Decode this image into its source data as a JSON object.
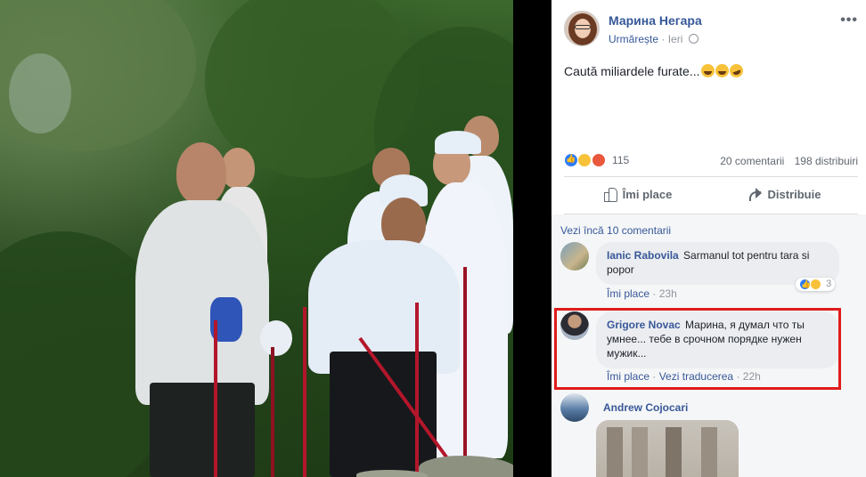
{
  "post": {
    "author": "Марина Негара",
    "follow_label": "Urmărește",
    "separator": "·",
    "time": "Ieri",
    "text": "Caută miliardele furate...",
    "reaction_count": "115",
    "comments_count": "20 comentarii",
    "shares_count": "198 distribuiri",
    "more_icon": "more-horizontal-icon"
  },
  "actions": {
    "like_label": "Îmi place",
    "share_label": "Distribuie"
  },
  "comments_section": {
    "view_more": "Vezi încă 10 comentarii",
    "comments": [
      {
        "name": "Ianic Rabovila",
        "text": "Sarmanul tot pentru tara si popor",
        "like_label": "Îmi place",
        "sep": "·",
        "time": "23h",
        "reaction_count": "3"
      },
      {
        "name": "Grigore Novac",
        "text": "Марина, я думал что ты умнее... тебе в срочном порядке нужен мужик...",
        "like_label": "Îmi place",
        "translate_label": "Vezi traducerea",
        "sep": "·",
        "time": "22h"
      },
      {
        "name": "Andrew Cojocari"
      }
    ]
  },
  "colors": {
    "link": "#365899",
    "highlight": "#e01b1b",
    "like_blue": "#2e7bf6",
    "haha_yellow": "#f7c23a",
    "angry_red": "#e9573d"
  }
}
